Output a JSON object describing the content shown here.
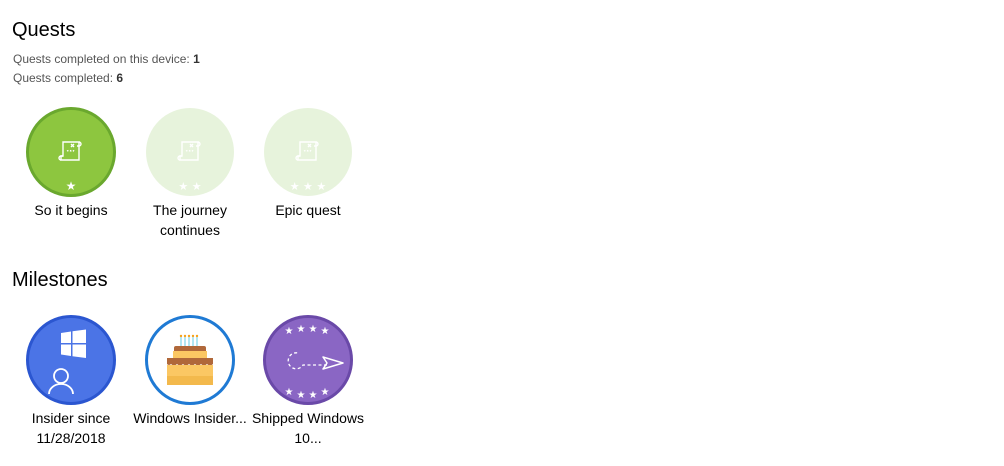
{
  "quests": {
    "title": "Quests",
    "device_label": "Quests completed on this device: ",
    "device_count": "1",
    "total_label": "Quests completed: ",
    "total_count": "6",
    "badges": [
      {
        "label": "So it begins",
        "icon": "scroll-icon",
        "stars": 1,
        "completed": true
      },
      {
        "label": "The journey continues",
        "icon": "scroll-icon",
        "stars": 2,
        "completed": false
      },
      {
        "label": "Epic quest",
        "icon": "scroll-icon",
        "stars": 3,
        "completed": false
      }
    ]
  },
  "milestones": {
    "title": "Milestones",
    "badges": [
      {
        "label": "Insider since 11/28/2018",
        "icon": "windows-user-icon"
      },
      {
        "label": "Windows Insider...",
        "icon": "birthday-cake-icon"
      },
      {
        "label": "Shipped Windows 10...",
        "icon": "paper-plane-icon"
      }
    ]
  },
  "colors": {
    "quest_complete_fill": "#8dc63f",
    "quest_complete_ring": "#6aa82e",
    "quest_incomplete_fill": "#e7f3dc",
    "insider_fill": "#4b74e6",
    "insider_ring": "#2b56d0",
    "cake_ring": "#1f7ad4",
    "shipped_fill": "#8a66c4",
    "shipped_ring": "#6a49a8"
  }
}
